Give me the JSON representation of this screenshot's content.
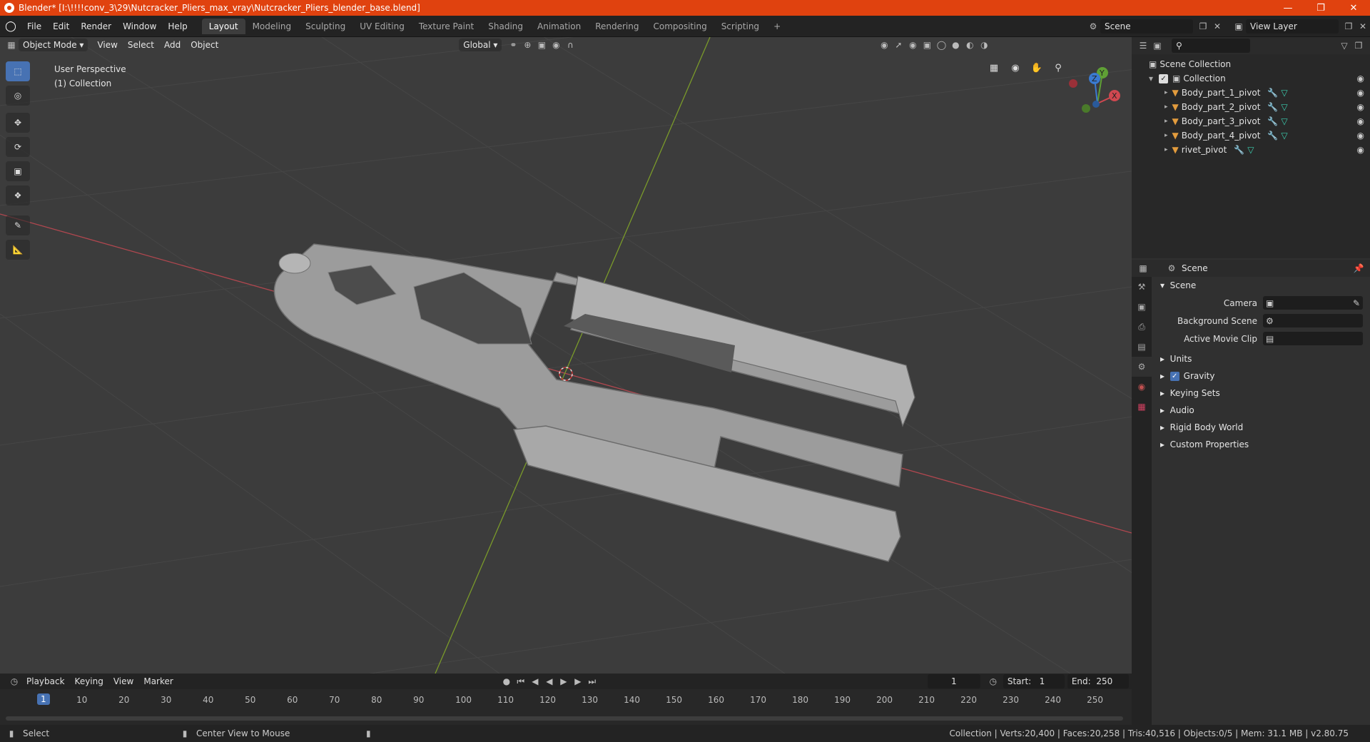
{
  "window": {
    "title": "Blender* [I:\\!!!!conv_3\\29\\Nutcracker_Pliers_max_vray\\Nutcracker_Pliers_blender_base.blend]",
    "controls": [
      "—",
      "❐",
      "✕"
    ]
  },
  "menu": [
    "File",
    "Edit",
    "Render",
    "Window",
    "Help"
  ],
  "workspace_tabs": [
    "Layout",
    "Modeling",
    "Sculpting",
    "UV Editing",
    "Texture Paint",
    "Shading",
    "Animation",
    "Rendering",
    "Compositing",
    "Scripting"
  ],
  "active_tab": "Layout",
  "scene_field": "Scene",
  "view_layer_field": "View Layer",
  "viewport_header": {
    "mode": "Object Mode",
    "menus": [
      "View",
      "Select",
      "Add",
      "Object"
    ],
    "orientation": "Global"
  },
  "viewport_overlay": {
    "line1": "User Perspective",
    "line2": "(1) Collection"
  },
  "gizmo": {
    "x": "X",
    "y": "Y",
    "z": "Z"
  },
  "outliner": {
    "root": "Scene Collection",
    "collection": "Collection",
    "items": [
      "Body_part_1_pivot",
      "Body_part_2_pivot",
      "Body_part_3_pivot",
      "Body_part_4_pivot",
      "rivet_pivot"
    ]
  },
  "properties": {
    "header": "Scene",
    "section": "Scene",
    "fields": [
      {
        "label": "Camera",
        "value": ""
      },
      {
        "label": "Background Scene",
        "value": ""
      },
      {
        "label": "Active Movie Clip",
        "value": ""
      }
    ],
    "panels": [
      "Units",
      "Gravity",
      "Keying Sets",
      "Audio",
      "Rigid Body World",
      "Custom Properties"
    ],
    "gravity_checked": true
  },
  "timeline": {
    "menus": [
      "Playback",
      "Keying",
      "View",
      "Marker"
    ],
    "current_frame": "1",
    "start_label": "Start:",
    "start": "1",
    "end_label": "End:",
    "end": "250",
    "ticks": [
      "1",
      "10",
      "20",
      "30",
      "40",
      "50",
      "60",
      "70",
      "80",
      "90",
      "100",
      "110",
      "120",
      "130",
      "140",
      "150",
      "160",
      "170",
      "180",
      "190",
      "200",
      "210",
      "220",
      "230",
      "240",
      "250"
    ]
  },
  "statusbar": {
    "left1": "Select",
    "left2": "Center View to Mouse",
    "right": "Collection | Verts:20,400 | Faces:20,258 | Tris:40,516 | Objects:0/5 | Mem: 31.1 MB | v2.80.75"
  },
  "colors": {
    "title": "#e0420f",
    "accent": "#4772b3",
    "object_icon": "#e39c3d",
    "modifier_icon": "#6aa4e8",
    "mesh_icon": "#3ccfb0"
  }
}
